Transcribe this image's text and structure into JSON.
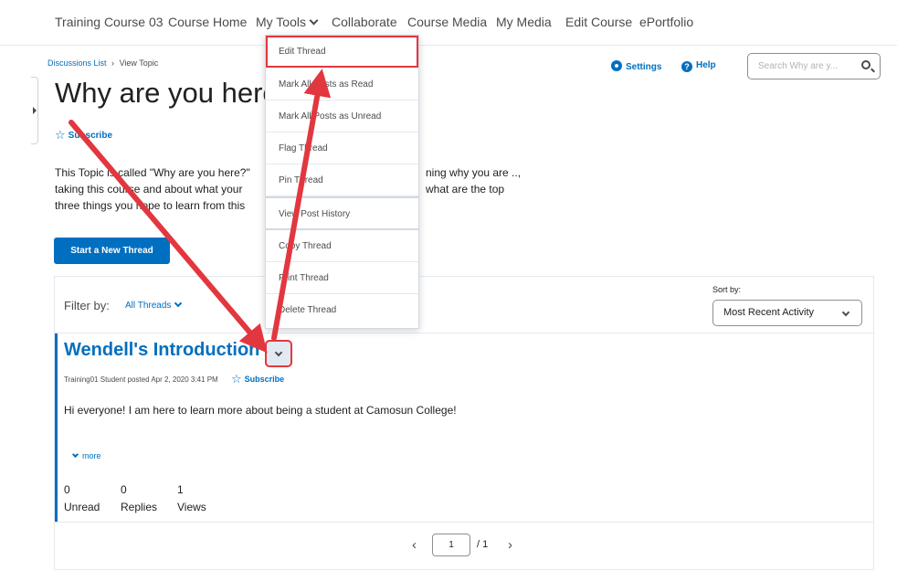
{
  "topnav": {
    "items": [
      "Training Course 03",
      "Course Home",
      "My Tools",
      "Collaborate",
      "Course Media",
      "My Media",
      "Edit Course",
      "ePortfolio"
    ]
  },
  "breadcrumb": {
    "parent": "Discussions List",
    "separator": "›",
    "current": "View Topic"
  },
  "header": {
    "title": "Why are you here?",
    "subscribe": "Subscribe",
    "settings": "Settings",
    "help": "Help",
    "search_placeholder": "Search Why are y...",
    "desc_left": "This Topic is called \"Why are you here?\" taking this course and about what your three things you hope to learn from this",
    "desc_right": "ning why you are .., what are the top",
    "new_thread": "Start a New Thread"
  },
  "filters": {
    "label": "Filter by:",
    "value": "All Threads",
    "sort_label": "Sort by:",
    "sort_value": "Most Recent Activity"
  },
  "thread": {
    "title": "Wendell's Introduction",
    "meta": "Training01 Student posted Apr 2, 2020 3:41 PM",
    "subscribe": "Subscribe",
    "body": "Hi everyone!  I am here to learn more about being a student at Camosun College!",
    "more": "more",
    "stats": [
      {
        "value": "0",
        "label": "Unread"
      },
      {
        "value": "0",
        "label": "Replies"
      },
      {
        "value": "1",
        "label": "Views"
      }
    ]
  },
  "pagination": {
    "prev": "‹",
    "page": "1",
    "total": "/ 1",
    "next": "›"
  },
  "menu": {
    "items": [
      "Edit Thread",
      "Mark All Posts as Read",
      "Mark All Posts as Unread",
      "Flag Thread",
      "Pin Thread",
      "View Post History",
      "Copy Thread",
      "Print Thread",
      "Delete Thread"
    ]
  },
  "colors": {
    "link": "#006fbf",
    "annotation": "#e2373f"
  }
}
